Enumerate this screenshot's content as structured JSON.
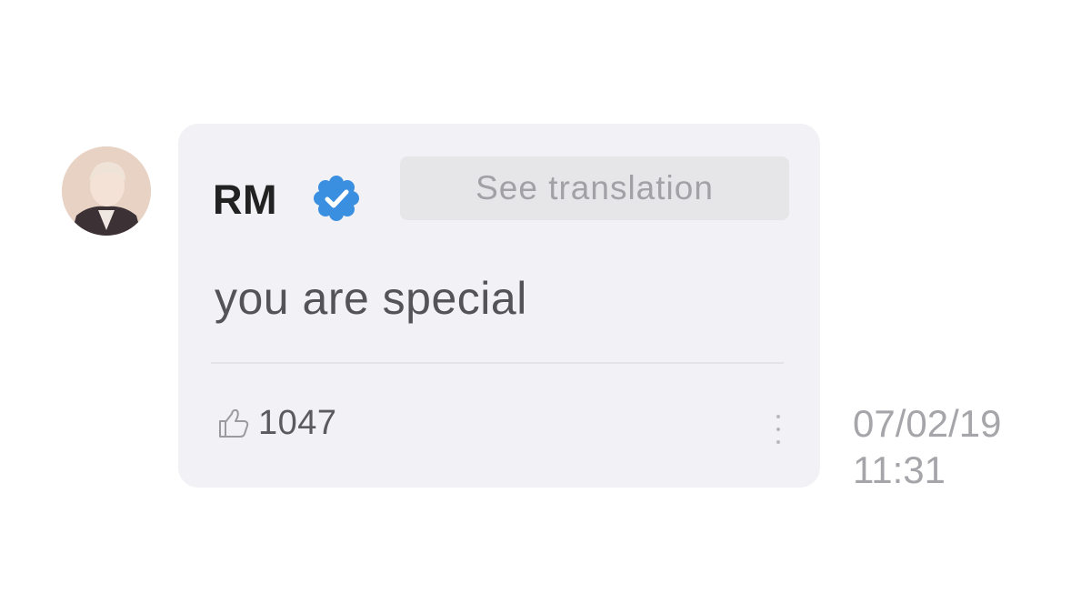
{
  "comment": {
    "avatar_icon": "user-avatar",
    "author": "RM",
    "verified_icon": "verified-badge-icon",
    "verified_color": "#3b8fe0",
    "translate_label": "See translation",
    "message": "you are special",
    "like_icon": "thumbs-up-icon",
    "like_count": "1047",
    "more_icon": "more-vertical-icon",
    "date": "07/02/19",
    "time": "11:31"
  }
}
